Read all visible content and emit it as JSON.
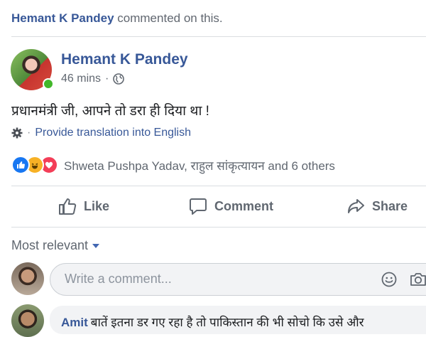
{
  "notice": {
    "actor": "Hemant K Pandey",
    "text": "commented on this."
  },
  "post": {
    "author": "Hemant K Pandey",
    "time": "46 mins",
    "separator": "·",
    "privacy_icon": "globe-icon",
    "text": "प्रधानमंत्री जी, आपने तो डरा ही दिया था !",
    "translate_link": "Provide translation into English",
    "reactions": [
      "like",
      "haha",
      "love"
    ],
    "reactors_text": "Shweta Pushpa Yadav, राहुल सांकृत्यायन and 6 others"
  },
  "actions": {
    "like": "Like",
    "comment": "Comment",
    "share": "Share"
  },
  "comments": {
    "sort_label": "Most relevant",
    "placeholder": "Write a comment...",
    "next_author": "Amit",
    "next_text": "बातें इतना डर गए रहा है तो पाकिस्तान की भी सोचो कि उसे और "
  },
  "colors": {
    "link": "#385898",
    "like": "#1877f2",
    "haha": "#f7b125",
    "love": "#f33e58",
    "online": "#42b72a"
  }
}
